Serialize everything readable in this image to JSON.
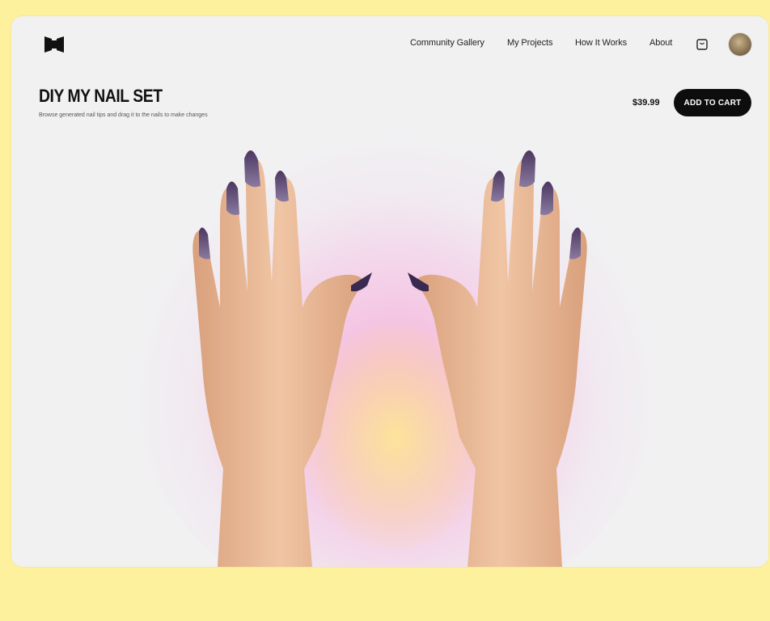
{
  "header": {
    "nav": [
      "Community Gallery",
      "My Projects",
      "How It Works",
      "About"
    ],
    "logo_icon": "butterfly-logo-icon",
    "cart_icon": "bag-icon",
    "avatar": "user-avatar"
  },
  "product": {
    "title": "DIY MY NAIL SET",
    "subtitle": "Browse generated nail tips and drag it to the nails to make changes",
    "price": "$39.99",
    "add_to_cart": "ADD TO CART"
  },
  "colors": {
    "page_background": "#fdf19d",
    "card_background": "#f1f1f2",
    "button_background": "#0d0d0d",
    "nail_color": "#6c5a86",
    "glow_pink": "#f5aad7",
    "glow_yellow": "#fce696"
  }
}
